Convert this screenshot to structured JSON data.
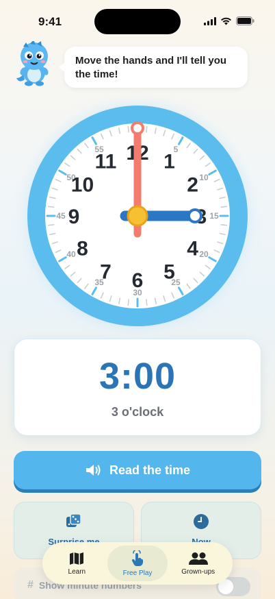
{
  "status_bar": {
    "time": "9:41"
  },
  "mascot": {
    "icon": "dino-mascot-icon"
  },
  "speech": {
    "text": "Move the hands and I'll tell you the time!"
  },
  "clock": {
    "hour_numbers": [
      "12",
      "1",
      "2",
      "3",
      "4",
      "5",
      "6",
      "7",
      "8",
      "9",
      "10",
      "11"
    ],
    "minute_labels": [
      "55",
      "5",
      "10",
      "15",
      "20",
      "25",
      "30",
      "35",
      "40",
      "45",
      "50"
    ],
    "hour": 3,
    "minute": 0,
    "colors": {
      "ring": "#5bbcee",
      "minute_hand": "#f47c6e",
      "hour_hand": "#2b77c1",
      "hub": "#f6c033"
    }
  },
  "time_display": {
    "digital": "3:00",
    "spoken": "3 o'clock"
  },
  "read_button": {
    "label": "Read the time",
    "icon": "speaker-icon"
  },
  "actions": {
    "surprise": {
      "label": "Surprise me",
      "icon": "dice-icon"
    },
    "now": {
      "label": "Now",
      "icon": "clock-icon"
    }
  },
  "toggle": {
    "label": "Show minute numbers",
    "icon": "hash-icon",
    "on": false
  },
  "tabs": [
    {
      "label": "Learn",
      "icon": "map-icon",
      "active": false
    },
    {
      "label": "Free Play",
      "icon": "tap-hand-icon",
      "active": true
    },
    {
      "label": "Grown-ups",
      "icon": "people-icon",
      "active": false
    }
  ],
  "accent_color": "#53b7ee"
}
